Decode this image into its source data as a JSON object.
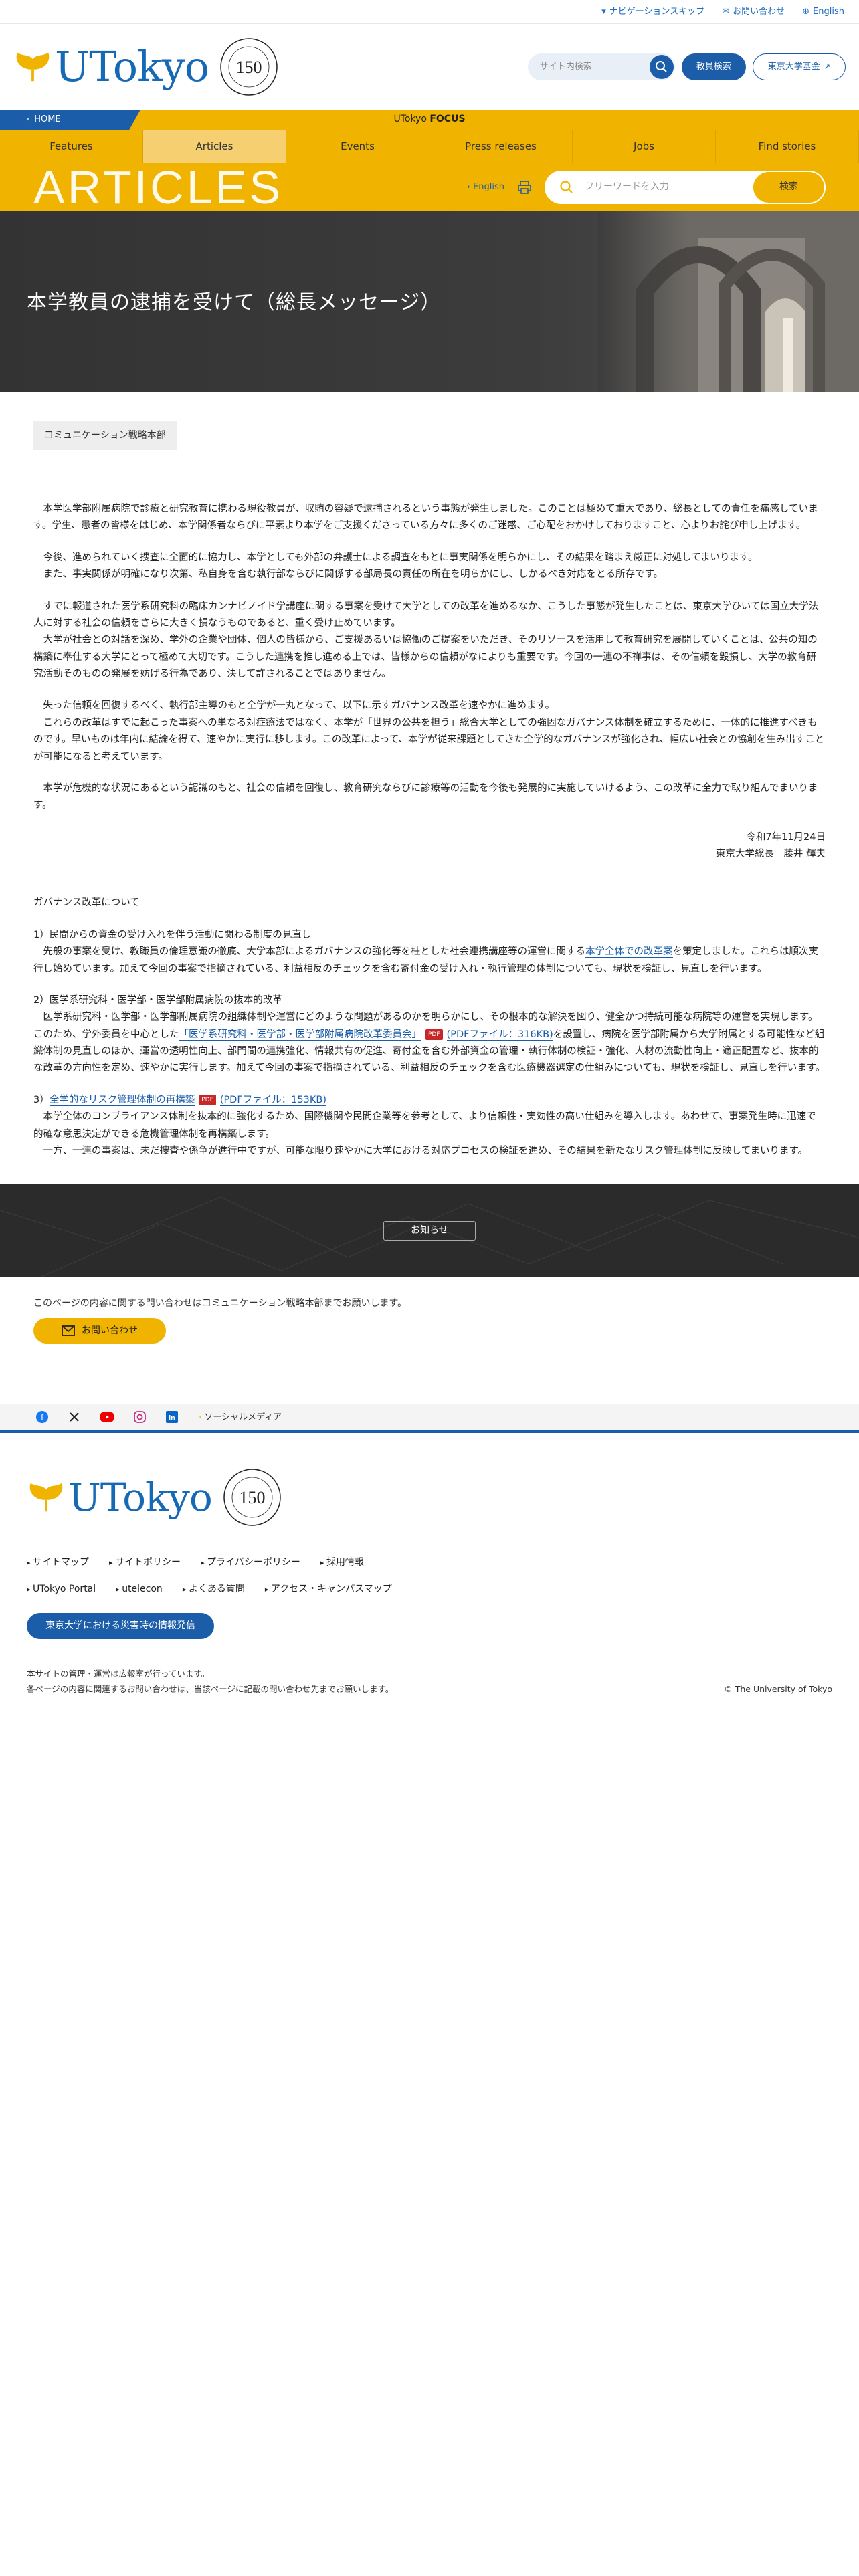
{
  "topbar": {
    "skip": "ナビゲーションスキップ",
    "contact": "お問い合わせ",
    "english": "English"
  },
  "header": {
    "logo_text": "UTokyo",
    "seal_text": "150",
    "search_placeholder": "サイト内検索",
    "faculty_search": "教員検索",
    "fund": "東京大学基金"
  },
  "focusbar": {
    "home": "HOME",
    "focus_prefix": "UTokyo ",
    "focus_bold": "FOCUS"
  },
  "nav": [
    "Features",
    "Articles",
    "Events",
    "Press releases",
    "Jobs",
    "Find stories"
  ],
  "subbar": {
    "title": "ARTICLES",
    "english": "English",
    "keyword_placeholder": "フリーワードを入力",
    "search_button": "検索"
  },
  "hero": {
    "title": "本学教員の逮捕を受けて（総長メッセージ）"
  },
  "dept": "コミュニケーション戦略本部",
  "paragraphs": [
    "　本学医学部附属病院で診療と研究教育に携わる現役教員が、収賄の容疑で逮捕されるという事態が発生しました。このことは極めて重大であり、総長としての責任を痛感しています。学生、患者の皆様をはじめ、本学関係者ならびに平素より本学をご支援くださっている方々に多くのご迷惑、ご心配をおかけしておりますこと、心よりお詫び申し上げます。",
    "　今後、進められていく捜査に全面的に協力し、本学としても外部の弁護士による調査をもとに事実関係を明らかにし、その結果を踏まえ厳正に対処してまいります。",
    "　また、事実関係が明確になり次第、私自身を含む執行部ならびに関係する部局長の責任の所在を明らかにし、しかるべき対応をとる所存です。",
    "　すでに報道された医学系研究科の臨床カンナビノイド学講座に関する事案を受けて大学としての改革を進めるなか、こうした事態が発生したことは、東京大学ひいては国立大学法人に対する社会の信頼をさらに大きく損なうものであると、重く受け止めています。",
    "　大学が社会との対話を深め、学外の企業や団体、個人の皆様から、ご支援あるいは協働のご提案をいただき、そのリソースを活用して教育研究を展開していくことは、公共の知の構築に奉仕する大学にとって極めて大切です。こうした連携を推し進める上では、皆様からの信頼がなによりも重要です。今回の一連の不祥事は、その信頼を毀損し、大学の教育研究活動そのものの発展を妨げる行為であり、決して許されることではありません。",
    "　失った信頼を回復するべく、執行部主導のもと全学が一丸となって、以下に示すガバナンス改革を速やかに進めます。",
    "　これらの改革はすでに起こった事案への単なる対症療法ではなく、本学が「世界の公共を担う」総合大学としての強固なガバナンス体制を確立するために、一体的に推進すべきものです。早いものは年内に結論を得て、速やかに実行に移します。この改革によって、本学が従来課題としてきた全学的なガバナンスが強化され、幅広い社会との協創を生み出すことが可能になると考えています。",
    "　本学が危機的な状況にあるという認識のもと、社会の信頼を回復し、教育研究ならびに診療等の活動を今後も発展的に実施していけるよう、この改革に全力で取り組んでまいります。"
  ],
  "signature": {
    "date": "令和7年11月24日",
    "name": "東京大学総長　藤井 輝夫"
  },
  "reform": {
    "heading": "ガバナンス改革について",
    "item1_title": "1）民間からの資金の受け入れを伴う活動に関わる制度の見直し",
    "item1_a": "　先般の事案を受け、教職員の倫理意識の徹底、大学本部によるガバナンスの強化等を柱とした社会連携講座等の運営に関する",
    "item1_link": "本学全体での改革案",
    "item1_b": "を策定しました。これらは順次実行し始めています。加えて今回の事案で指摘されている、利益相反のチェックを含む寄付金の受け入れ・執行管理の体制についても、現状を検証し、見直しを行います。",
    "item2_title": "2）医学系研究科・医学部・医学部附属病院の抜本的改革",
    "item2_a": "　医学系研究科・医学部・医学部附属病院の組織体制や運営にどのような問題があるのかを明らかにし、その根本的な解決を図り、健全かつ持続可能な病院等の運営を実現します。このため、学外委員を中心とした",
    "item2_link": "「医学系研究科・医学部・医学部附属病院改革委員会」",
    "item2_pdf": "(PDFファイル：316KB)",
    "item2_b": "を設置し、病院を医学部附属から大学附属とする可能性など組織体制の見直しのほか、運営の透明性向上、部門間の連携強化、情報共有の促進、寄付金を含む外部資金の管理・執行体制の検証・強化、人材の流動性向上・適正配置など、抜本的な改革の方向性を定め、速やかに実行します。加えて今回の事案で指摘されている、利益相反のチェックを含む医療機器選定の仕組みについても、現状を検証し、見直しを行います。",
    "item3_prefix": "3）",
    "item3_link": "全学的なリスク管理体制の再構築",
    "item3_pdf": "(PDFファイル：153KB)",
    "item3_a": "　本学全体のコンプライアンス体制を抜本的に強化するため、国際機関や民間企業等を参考として、より信頼性・実効性の高い仕組みを導入します。あわせて、事案発生時に迅速で的確な意思決定ができる危機管理体制を再構築します。",
    "item3_b": "　一方、一連の事案は、未だ捜査や係争が進行中ですが、可能な限り速やかに大学における対応プロセスの検証を進め、その結果を新たなリスク管理体制に反映してまいります。",
    "pdf_badge": "PDF"
  },
  "notice_button": "お知らせ",
  "contact": {
    "text": "このページの内容に関する問い合わせはコミュニケーション戦略本部までお願いします。",
    "button": "お問い合わせ"
  },
  "social": {
    "label": "ソーシャルメディア"
  },
  "footer": {
    "links": [
      "サイトマップ",
      "サイトポリシー",
      "プライバシーポリシー",
      "採用情報",
      "UTokyo Portal",
      "utelecon",
      "よくある質問",
      "アクセス・キャンパスマップ"
    ],
    "disaster": "東京大学における災害時の情報発信",
    "note1": "本サイトの管理・運営は広報室が行っています。",
    "note2": "各ページの内容に関連するお問い合わせは、当該ページに記載の問い合わせ先までお願いします。",
    "copyright": "© The University of Tokyo"
  },
  "colors": {
    "brand_blue": "#1b5da8",
    "accent_yellow": "#f0b400",
    "dark": "#2b2b2b"
  }
}
